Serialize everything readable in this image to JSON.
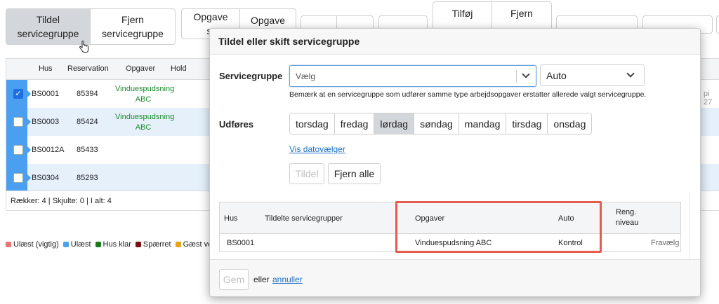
{
  "toolbar": {
    "assign_line1": "Tildel",
    "assign_line2": "servicegruppe",
    "remove_line1": "Fjern",
    "remove_line2": "servicegruppe",
    "task_line1a": "Opgave",
    "task_line2a": "st",
    "task_line1b": "Opgave",
    "add_label": "Tilføj",
    "remove2_label": "Fjern"
  },
  "table": {
    "headers": [
      "Hus",
      "Reservation",
      "Opgaver",
      "Hold"
    ],
    "rows": [
      {
        "house": "BS0001",
        "reservation": "85394",
        "task_line1": "Vinduespudsning",
        "task_line2": "ABC",
        "checked": true
      },
      {
        "house": "BS0003",
        "reservation": "85424",
        "task_line1": "Vinduespudsning",
        "task_line2": "ABC",
        "checked": false
      },
      {
        "house": "BS0012A",
        "reservation": "85433",
        "task_line1": "",
        "task_line2": "",
        "checked": false
      },
      {
        "house": "BS0304",
        "reservation": "85293",
        "task_line1": "",
        "task_line2": "",
        "checked": false
      }
    ],
    "footer": "Rækker: 4 | Skjulte: 0 | I alt: 4",
    "right_edge_text": "pi 27"
  },
  "legend": [
    {
      "label": "Ulæst (vigtig)",
      "color": "#e87474"
    },
    {
      "label": "Ulæst",
      "color": "#4aa3e8"
    },
    {
      "label": "Hus klar",
      "color": "#1a7a1a"
    },
    {
      "label": "Spærret",
      "color": "#7a1010"
    },
    {
      "label": "Gæst venter",
      "color": "#e8a21a"
    }
  ],
  "modal": {
    "title": "Tildel eller skift servicegruppe",
    "servicegroup_label": "Servicegruppe",
    "servicegroup_placeholder": "Vælg",
    "auto_value": "Auto",
    "note": "Bemærk at en servicegruppe som udfører samme type arbejdsopgaver erstatter allerede valgt servicegruppe.",
    "performed_label": "Udføres",
    "days": [
      "torsdag",
      "fredag",
      "lørdag",
      "søndag",
      "mandag",
      "tirsdag",
      "onsdag"
    ],
    "selected_day": "lørdag",
    "show_datepicker": "Vis datovælger",
    "assign_button": "Tildel",
    "remove_all_button": "Fjern alle",
    "inner_table": {
      "headers": {
        "house": "Hus",
        "assigned": "Tildelte servicegrupper",
        "tasks": "Opgaver",
        "auto": "Auto",
        "clean_line1": "Reng.",
        "clean_line2": "niveau"
      },
      "row": {
        "house": "BS0001",
        "assigned": "",
        "tasks": "Vinduespudsning ABC",
        "auto": "Kontrol",
        "clean": "Fravælg"
      }
    },
    "save_button": "Gem",
    "or_text": "eller",
    "cancel_link": "annuller"
  }
}
